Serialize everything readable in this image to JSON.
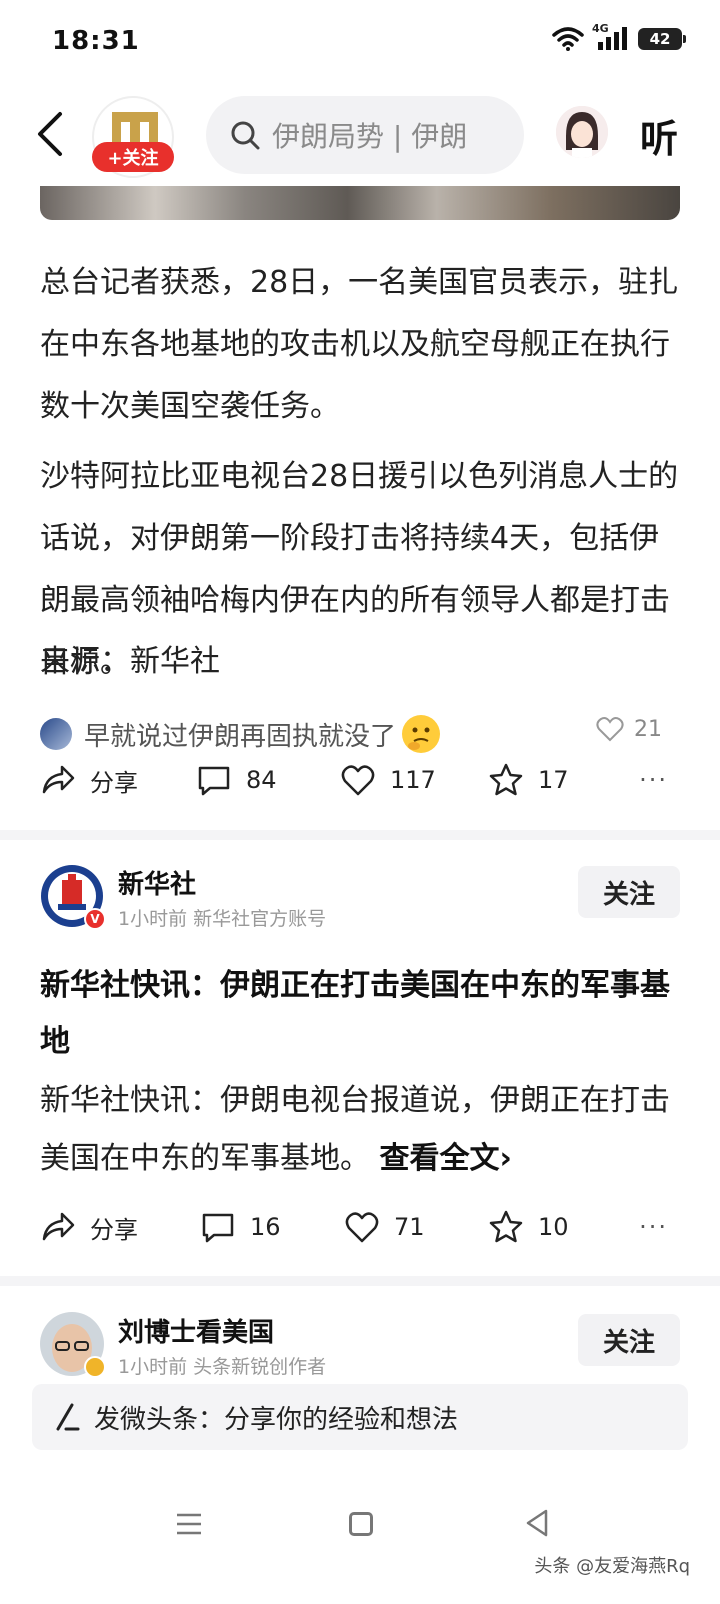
{
  "status": {
    "time": "18:31",
    "network": "4G",
    "battery": "42"
  },
  "topbar": {
    "follow_badge": "+关注",
    "search_placeholder": "伊朗局势 | 伊朗",
    "listen": "听"
  },
  "article": {
    "paragraphs": [
      "总台记者获悉，28日，一名美国官员表示，驻扎在中东各地基地的攻击机以及航空母舰正在执行数十次美国空袭任务。",
      "沙特阿拉比亚电视台28日援引以色列消息人士的话说，对伊朗第一阶段打击将持续4天，包括伊朗最高领袖哈梅内伊在内的所有领导人都是打击目标。"
    ],
    "source": "来源：新华社",
    "top_comment": {
      "text": "早就说过伊朗再固执就没了",
      "likes": "21"
    },
    "actions": {
      "share": "分享",
      "comments": "84",
      "likes": "117",
      "favorites": "17"
    }
  },
  "post1": {
    "author": "新华社",
    "badge": "V",
    "meta": "1小时前   新华社官方账号",
    "follow": "关注",
    "title": "新华社快讯：伊朗正在打击美国在中东的军事基地",
    "body": "新华社快讯：伊朗电视台报道说，伊朗正在打击美国在中东的军事基地。",
    "read_more": "查看全文›",
    "actions": {
      "share": "分享",
      "comments": "16",
      "likes": "71",
      "favorites": "10"
    }
  },
  "post2": {
    "author": "刘博士看美国",
    "meta": "1小时前   头条新锐创作者",
    "follow": "关注"
  },
  "composer": {
    "text": "发微头条：分享你的经验和想法"
  },
  "watermark": "头条 @友爱海燕Rq"
}
